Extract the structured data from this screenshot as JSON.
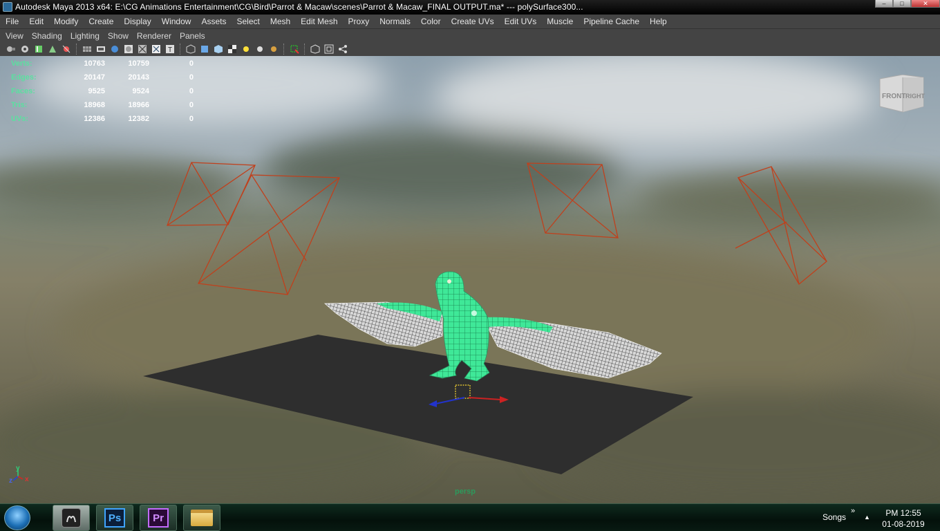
{
  "window": {
    "title": "Autodesk Maya 2013 x64: E:\\CG Animations Entertainment\\CG\\Bird\\Parrot & Macaw\\scenes\\Parrot & Macaw_FINAL OUTPUT.ma*    ---    polySurface300...",
    "buttons": {
      "minimize": "‒",
      "maximize": "□",
      "close": "✕"
    }
  },
  "menubar": {
    "items": [
      "File",
      "Edit",
      "Modify",
      "Create",
      "Display",
      "Window",
      "Assets",
      "Select",
      "Mesh",
      "Edit Mesh",
      "Proxy",
      "Normals",
      "Color",
      "Create UVs",
      "Edit UVs",
      "Muscle",
      "Pipeline Cache",
      "Help"
    ]
  },
  "panel_menu": {
    "items": [
      "View",
      "Shading",
      "Lighting",
      "Show",
      "Renderer",
      "Panels"
    ]
  },
  "hud": {
    "rows": [
      {
        "label": "Verts:",
        "total": "10763",
        "selected": "10759",
        "third": "0"
      },
      {
        "label": "Edges:",
        "total": "20147",
        "selected": "20143",
        "third": "0"
      },
      {
        "label": "Faces:",
        "total": "9525",
        "selected": "9524",
        "third": "0"
      },
      {
        "label": "Tris:",
        "total": "18968",
        "selected": "18966",
        "third": "0"
      },
      {
        "label": "UVs:",
        "total": "12386",
        "selected": "12382",
        "third": "0"
      }
    ]
  },
  "viewcube": {
    "front": "FRONT",
    "right": "RIGHT"
  },
  "camera_label": "persp",
  "axis": {
    "y": "y",
    "z": "z",
    "x": "x"
  },
  "taskbar": {
    "apps": [
      "Maya",
      "Ps",
      "Pr",
      "Explorer"
    ],
    "tray_label": "Songs",
    "tray_chevron": "»",
    "tray_up": "▲",
    "time": "PM 12:55",
    "date": "01-08-2019"
  },
  "colors": {
    "hud_label": "#5be0a0",
    "wireframe": "#3fe898",
    "camera_frame": "#c0401c",
    "ground": "#2e2e2e"
  }
}
